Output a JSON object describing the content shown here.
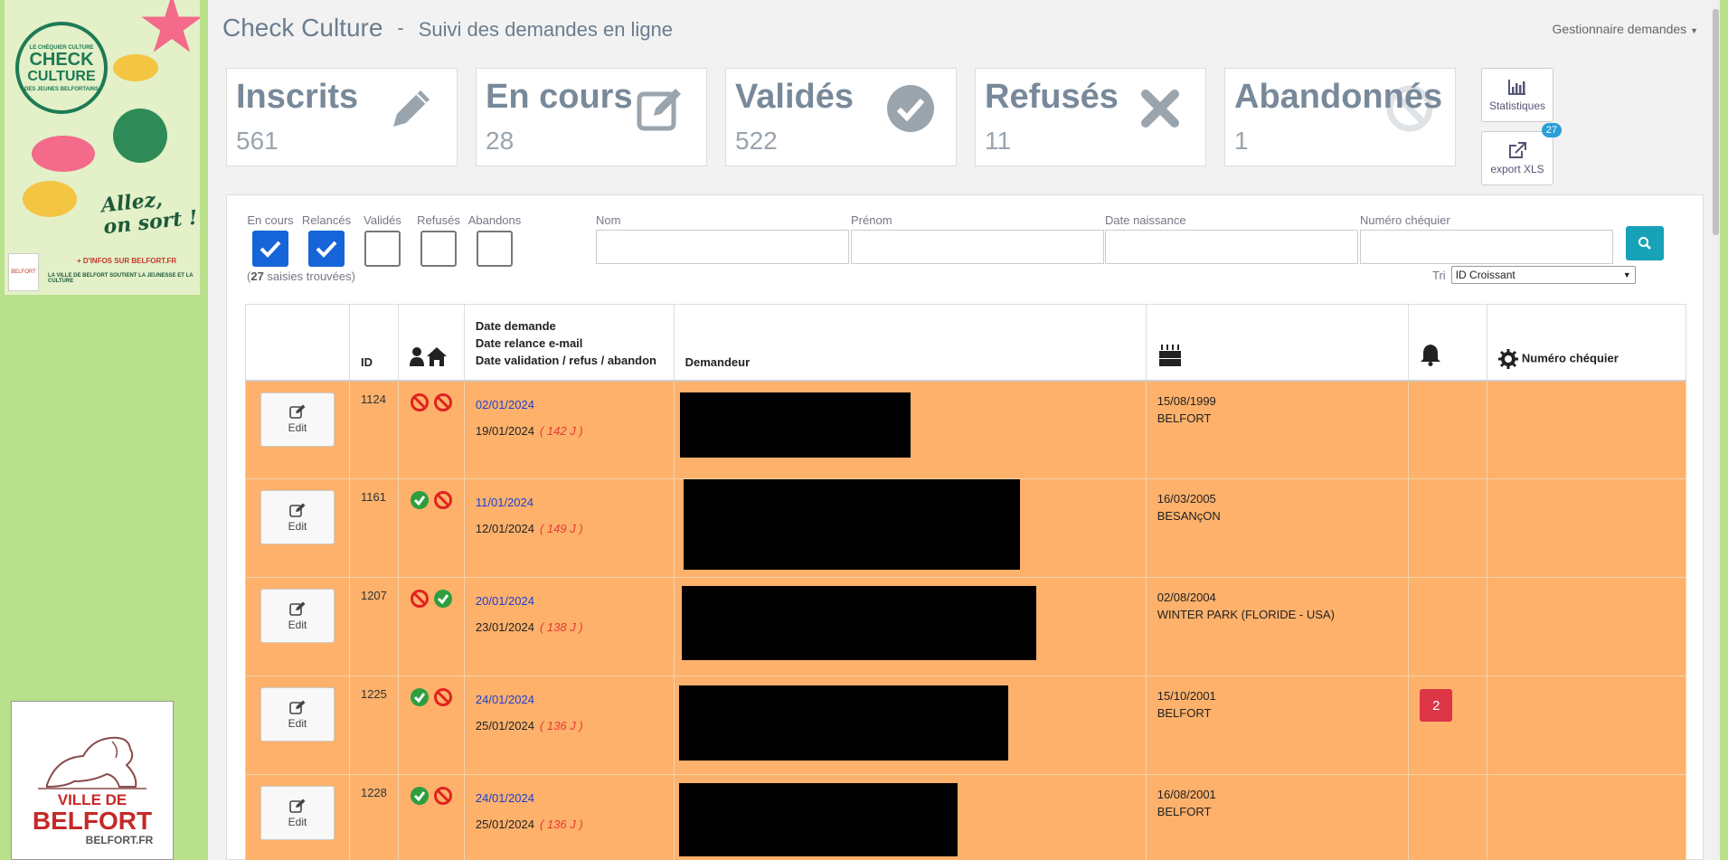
{
  "sidebar": {
    "poster": {
      "badge_top": "LE CHÉQUIER CULTURE",
      "badge_line1": "CHECK",
      "badge_line2": "CULTURE",
      "badge_bottom": "DES JEUNES BELFORTAINS",
      "slogan_line1": "Allez,",
      "slogan_line2": "on sort !",
      "info_link": "+ D'INFOS SUR BELFORT.FR",
      "support_text": "LA VILLE DE BELFORT SOUTIENT LA JEUNESSE ET LA CULTURE",
      "mini_logo_text": "BELFORT"
    },
    "ville": {
      "line1": "VILLE DE",
      "line2": "BELFORT",
      "line3": "BELFORT.FR"
    }
  },
  "header": {
    "brand": "Check Culture",
    "separator": "-",
    "subtitle": "Suivi des demandes en ligne",
    "user_menu": "Gestionnaire demandes"
  },
  "tiles": [
    {
      "label": "Inscrits",
      "count": "561",
      "icon": "pencil-icon"
    },
    {
      "label": "En cours",
      "count": "28",
      "icon": "edit-icon"
    },
    {
      "label": "Validés",
      "count": "522",
      "icon": "check-circle-icon"
    },
    {
      "label": "Refusés",
      "count": "11",
      "icon": "times-icon"
    },
    {
      "label": "Abandonnés",
      "count": "1",
      "icon": "ban-icon"
    }
  ],
  "actions": {
    "stats_label": "Statistiques",
    "export_label": "export XLS",
    "export_badge": "27"
  },
  "filters": {
    "checks": [
      {
        "label": "En cours",
        "checked": true
      },
      {
        "label": "Relancés",
        "checked": true
      },
      {
        "label": "Validés",
        "checked": false
      },
      {
        "label": "Refusés",
        "checked": false
      },
      {
        "label": "Abandons",
        "checked": false
      }
    ],
    "found_count": "27",
    "found_prefix": "(",
    "found_suffix": " saisies trouvées)",
    "fields": {
      "nom": {
        "label": "Nom",
        "value": ""
      },
      "prenom": {
        "label": "Prénom",
        "value": ""
      },
      "naissance": {
        "label": "Date naissance",
        "value": ""
      },
      "numero": {
        "label": "Numéro chéquier",
        "value": ""
      }
    },
    "sort_label": "Tri",
    "sort_value": "ID Croissant"
  },
  "table": {
    "headers": {
      "id": "ID",
      "dates_line1": "Date demande",
      "dates_line2": "Date relance e-mail",
      "dates_line3": "Date validation / refus / abandon",
      "demandeur": "Demandeur",
      "numero": "Numéro chéquier"
    },
    "edit_label": "Edit",
    "rows": [
      {
        "id": "1124",
        "status": [
          "ban",
          "ban"
        ],
        "date_demande": "02/01/2024",
        "date_second": "19/01/2024",
        "days": "( 142 J )",
        "birth": "15/08/1999",
        "city": "BELFORT",
        "notif": ""
      },
      {
        "id": "1161",
        "status": [
          "ok",
          "ban"
        ],
        "date_demande": "11/01/2024",
        "date_second": "12/01/2024",
        "days": "( 149 J )",
        "birth": "16/03/2005",
        "city": "BESANçON",
        "notif": ""
      },
      {
        "id": "1207",
        "status": [
          "ban",
          "ok"
        ],
        "date_demande": "20/01/2024",
        "date_second": "23/01/2024",
        "days": "( 138 J )",
        "birth": "02/08/2004",
        "city": "WINTER PARK (FLORIDE - USA)",
        "notif": ""
      },
      {
        "id": "1225",
        "status": [
          "ok",
          "ban"
        ],
        "date_demande": "24/01/2024",
        "date_second": "25/01/2024",
        "days": "( 136 J )",
        "birth": "15/10/2001",
        "city": "BELFORT",
        "notif": "2"
      },
      {
        "id": "1228",
        "status": [
          "ok",
          "ban"
        ],
        "date_demande": "24/01/2024",
        "date_second": "25/01/2024",
        "days": "( 136 J )",
        "birth": "16/08/2001",
        "city": "BELFORT",
        "notif": ""
      }
    ]
  },
  "colors": {
    "row_bg": "#fdb16b",
    "accent_blue": "#1565d8",
    "search_btn": "#17a2b8",
    "notif_red": "#dc3545"
  }
}
